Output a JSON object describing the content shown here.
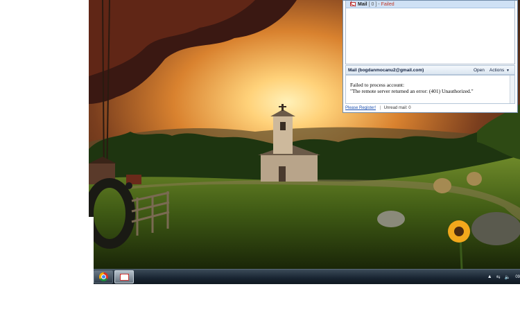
{
  "mail_popup": {
    "list_row": {
      "account": "Mail",
      "count": "[ 0 ] -",
      "status": "Failed"
    },
    "header": {
      "title": "Mail (bogdanmocanu2@gmail.com)",
      "open_label": "Open",
      "actions_label": "Actions",
      "actions_caret": "▼"
    },
    "body": {
      "line1": "Failed to process account:",
      "line2": "\"The remote server returned an error: (401) Unauthorized.\""
    },
    "footer": {
      "register_link": "Please Register!",
      "separator": "|",
      "unread": "Unread mail: 0"
    }
  },
  "taskbar": {
    "buttons": [
      {
        "icon": "chrome-icon",
        "active": false
      },
      {
        "icon": "gmail-icon",
        "active": true
      }
    ],
    "tray": {
      "show_hidden": "▲",
      "network": "⇆",
      "volume": "🔈",
      "clock": "09"
    }
  },
  "colors": {
    "sky_top": "#2a1a12",
    "sun": "#ffd27a",
    "grass": "#4d6a1c",
    "taskbar": "#1a2632"
  }
}
